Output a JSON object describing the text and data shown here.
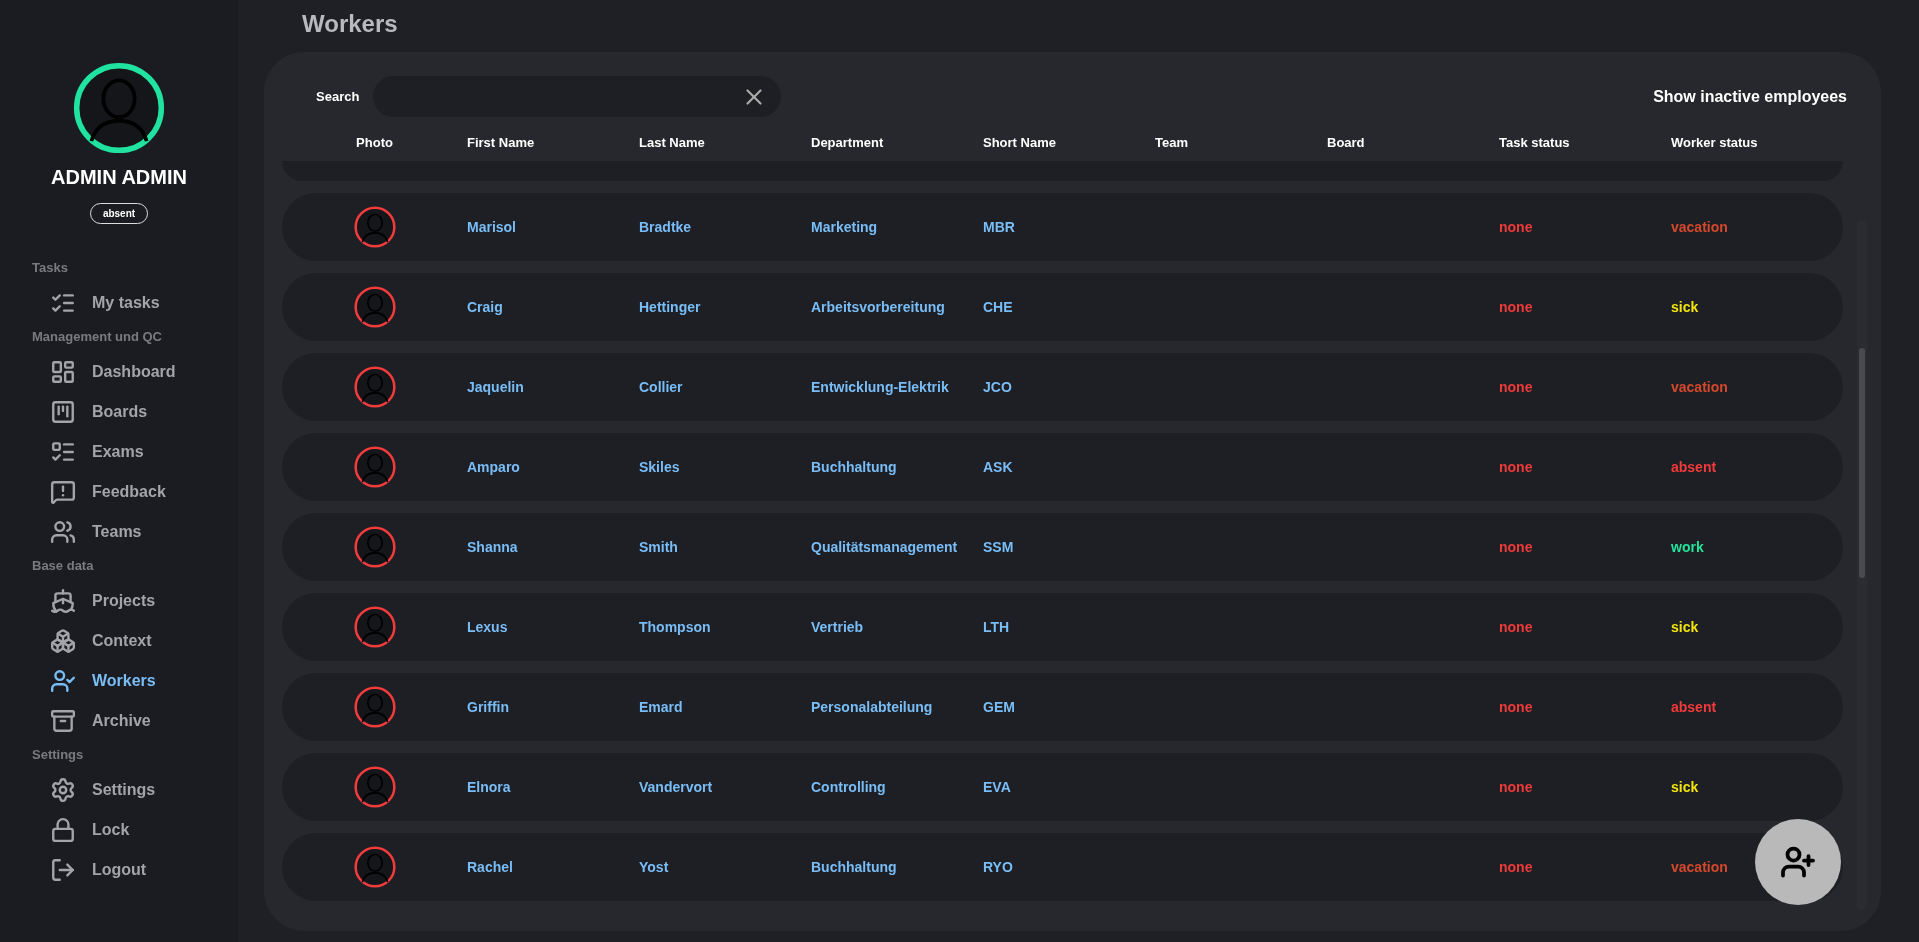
{
  "profile": {
    "name": "ADMIN ADMIN",
    "status": "absent"
  },
  "sidebar": {
    "sections": [
      {
        "title": "Tasks",
        "items": [
          {
            "kind": "tasks",
            "label": "My tasks",
            "selected": false
          }
        ]
      },
      {
        "title": "Management und QC",
        "items": [
          {
            "kind": "dashboard",
            "label": "Dashboard",
            "selected": false
          },
          {
            "kind": "boards",
            "label": "Boards",
            "selected": false
          },
          {
            "kind": "exams",
            "label": "Exams",
            "selected": false
          },
          {
            "kind": "feedback",
            "label": "Feedback",
            "selected": false
          },
          {
            "kind": "teams",
            "label": "Teams",
            "selected": false
          }
        ]
      },
      {
        "title": "Base data",
        "items": [
          {
            "kind": "projects",
            "label": "Projects",
            "selected": false
          },
          {
            "kind": "context",
            "label": "Context",
            "selected": false
          },
          {
            "kind": "workers",
            "label": "Workers",
            "selected": true
          },
          {
            "kind": "archive",
            "label": "Archive",
            "selected": false
          }
        ]
      },
      {
        "title": "Settings",
        "items": [
          {
            "kind": "settings",
            "label": "Settings",
            "selected": false
          },
          {
            "kind": "lock",
            "label": "Lock",
            "selected": false
          },
          {
            "kind": "logout",
            "label": "Logout",
            "selected": false
          }
        ]
      }
    ]
  },
  "page": {
    "title": "Workers"
  },
  "search": {
    "label": "Search"
  },
  "toggle": {
    "label": "Show inactive employees"
  },
  "table": {
    "columns": [
      "Photo",
      "First Name",
      "Last Name",
      "Department",
      "Short Name",
      "Team",
      "Board",
      "Task status",
      "Worker status"
    ],
    "rows": [
      {
        "first_name": "Marisol",
        "last_name": "Bradtke",
        "department": "Marketing",
        "short_name": "MBR",
        "task_status": "none",
        "worker_status": "vacation",
        "color": "#d4482c"
      },
      {
        "first_name": "Craig",
        "last_name": "Hettinger",
        "department": "Arbeitsvorbereitung",
        "short_name": "CHE",
        "task_status": "none",
        "worker_status": "sick",
        "color": "#f2e40c"
      },
      {
        "first_name": "Jaquelin",
        "last_name": "Collier",
        "department": "Entwicklung-Elektrik",
        "short_name": "JCO",
        "task_status": "none",
        "worker_status": "vacation",
        "color": "#d4482c"
      },
      {
        "first_name": "Amparo",
        "last_name": "Skiles",
        "department": "Buchhaltung",
        "short_name": "ASK",
        "task_status": "none",
        "worker_status": "absent",
        "color": "#f23a3a"
      },
      {
        "first_name": "Shanna",
        "last_name": "Smith",
        "department": "Qualitätsmanagement",
        "short_name": "SSM",
        "task_status": "none",
        "worker_status": "work",
        "color": "#22e39a"
      },
      {
        "first_name": "Lexus",
        "last_name": "Thompson",
        "department": "Vertrieb",
        "short_name": "LTH",
        "task_status": "none",
        "worker_status": "sick",
        "color": "#f2e40c"
      },
      {
        "first_name": "Griffin",
        "last_name": "Emard",
        "department": "Personalabteilung",
        "short_name": "GEM",
        "task_status": "none",
        "worker_status": "absent",
        "color": "#f23a3a"
      },
      {
        "first_name": "Elnora",
        "last_name": "Vandervort",
        "department": "Controlling",
        "short_name": "EVA",
        "task_status": "none",
        "worker_status": "sick",
        "color": "#f2e40c"
      },
      {
        "first_name": "Rachel",
        "last_name": "Yost",
        "department": "Buchhaltung",
        "short_name": "RYO",
        "task_status": "none",
        "worker_status": "vacation",
        "color": "#d4482c"
      }
    ]
  }
}
